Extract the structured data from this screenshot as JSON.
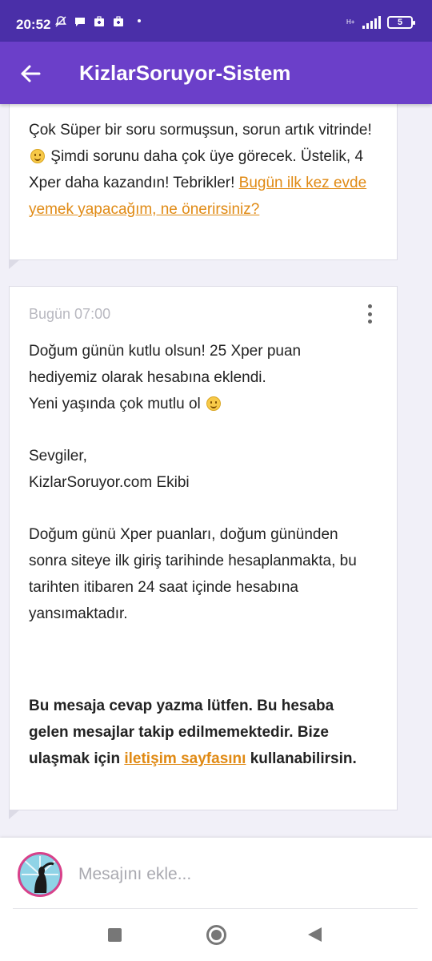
{
  "status_bar": {
    "time": "20:52",
    "network_type": "H+",
    "battery_level": "5"
  },
  "app_bar": {
    "title": "KizlarSoruyor-Sistem"
  },
  "messages": [
    {
      "text": "Çok Süper bir soru sormuşsun, sorun artık vitrinde!",
      "text_after_smiley": "Şimdi sorunu daha çok üye görecek. Üstelik, 4 Xper daha kazandın! Tebrikler!",
      "link_text": "Bugün ilk kez evde yemek yapacağım, ne önerirsiniz?"
    },
    {
      "time": "Bugün 07:00",
      "para1": "Doğum günün kutlu olsun! 25 Xper puan hediyemiz olarak hesabına eklendi.",
      "para1b": "Yeni yaşında çok mutlu ol",
      "signoff_1": "Sevgiler,",
      "signoff_2": "KizlarSoruyor.com Ekibi",
      "para2": "Doğum günü Xper puanları, doğum gününden sonra siteye ilk giriş tarihinde hesaplanmakta, bu tarihten itibaren 24 saat içinde hesabına yansımaktadır.",
      "notice_before": "Bu mesaja cevap yazma lütfen. Bu hesaba gelen mesajlar takip edilmemektedir. Bize ulaşmak için",
      "notice_link": "iletişim sayfasını",
      "notice_after": "kullanabilirsin."
    }
  ],
  "composer": {
    "placeholder": "Mesajını ekle..."
  },
  "colors": {
    "status_bar": "#4a2fa8",
    "app_bar": "#6b3fc9",
    "link": "#e08a14",
    "background": "#f1f0f8"
  },
  "icons": {
    "status_left": [
      "mute-icon",
      "chat-bubble-icon",
      "briefcase-icon",
      "briefcase-icon"
    ],
    "app_bar": "arrow-left-icon",
    "card_menu": "more-vertical-icon",
    "emoji": "smiley-icon",
    "nav": [
      "square-icon",
      "home-circle-icon",
      "back-triangle-icon"
    ]
  }
}
